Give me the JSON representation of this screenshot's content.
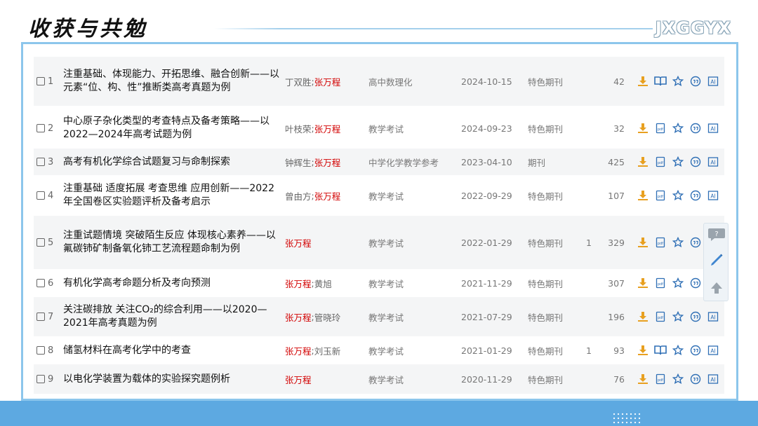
{
  "slide": {
    "title": "收获与共勉",
    "brand": "JXGGYX"
  },
  "colors": {
    "frame": "#8cc6ec",
    "band": "#5da9e1",
    "author_highlight": "#d20000",
    "icon_blue": "#2f6fb5",
    "icon_orange": "#e8a020"
  },
  "rows": [
    {
      "num": "1",
      "title": "注重基础、体现能力、开拓思维、融合创新——以元素“位、构、性”推断类高考真题为例",
      "authors": [
        {
          "name": "丁双胜",
          "hl": false
        },
        {
          "name": "张万程",
          "hl": true
        }
      ],
      "source": "高中数理化",
      "date": "2024-10-15",
      "dbtype": "特色期刊",
      "cited": "",
      "downloads": "42",
      "read_icon": "book"
    },
    {
      "num": "2",
      "title": "中心原子杂化类型的考查特点及备考策略——以2022—2024年高考试题为例",
      "authors": [
        {
          "name": "叶枝荣",
          "hl": false
        },
        {
          "name": "张万程",
          "hl": true
        }
      ],
      "source": "教学考试",
      "date": "2024-09-23",
      "dbtype": "特色期刊",
      "cited": "",
      "downloads": "32",
      "read_icon": "page"
    },
    {
      "num": "3",
      "title": "高考有机化学综合试题复习与命制探索",
      "authors": [
        {
          "name": "钟辉生",
          "hl": false
        },
        {
          "name": "张万程",
          "hl": true
        }
      ],
      "source": "中学化学教学参考",
      "date": "2023-04-10",
      "dbtype": "期刊",
      "cited": "",
      "downloads": "425",
      "read_icon": "page"
    },
    {
      "num": "4",
      "title": "注重基础 适度拓展 考查思维 应用创新——2022年全国卷区实验题评析及备考启示",
      "authors": [
        {
          "name": "曾由方",
          "hl": false
        },
        {
          "name": "张万程",
          "hl": true
        }
      ],
      "source": "教学考试",
      "date": "2022-09-29",
      "dbtype": "特色期刊",
      "cited": "",
      "downloads": "107",
      "read_icon": "page"
    },
    {
      "num": "5",
      "title": "注重试题情境 突破陌生反应 体现核心素养——以氟碳铈矿制备氧化铈工艺流程题命制为例",
      "authors": [
        {
          "name": "张万程",
          "hl": true
        }
      ],
      "source": "教学考试",
      "date": "2022-01-29",
      "dbtype": "特色期刊",
      "cited": "1",
      "downloads": "329",
      "read_icon": "page"
    },
    {
      "num": "6",
      "title": "有机化学高考命题分析及考向预测",
      "authors": [
        {
          "name": "张万程",
          "hl": true
        },
        {
          "name": "黄旭",
          "hl": false
        }
      ],
      "source": "教学考试",
      "date": "2021-11-29",
      "dbtype": "特色期刊",
      "cited": "",
      "downloads": "307",
      "read_icon": "page"
    },
    {
      "num": "7",
      "title": "关注碳排放 关注CO₂的综合利用——以2020—2021年高考真题为例",
      "authors": [
        {
          "name": "张万程",
          "hl": true
        },
        {
          "name": "管晓玲",
          "hl": false
        }
      ],
      "source": "教学考试",
      "date": "2021-07-29",
      "dbtype": "特色期刊",
      "cited": "",
      "downloads": "196",
      "read_icon": "page"
    },
    {
      "num": "8",
      "title": "储氢材料在高考化学中的考查",
      "authors": [
        {
          "name": "张万程",
          "hl": true
        },
        {
          "name": "刘玉新",
          "hl": false
        }
      ],
      "source": "教学考试",
      "date": "2021-01-29",
      "dbtype": "特色期刊",
      "cited": "1",
      "downloads": "93",
      "read_icon": "book"
    },
    {
      "num": "9",
      "title": "以电化学装置为载体的实验探究题例析",
      "authors": [
        {
          "name": "张万程",
          "hl": true
        }
      ],
      "source": "教学考试",
      "date": "2020-11-29",
      "dbtype": "特色期刊",
      "cited": "",
      "downloads": "76",
      "read_icon": "page"
    }
  ],
  "row_ops": [
    "download-icon",
    "read-icon",
    "favorite-icon",
    "quote-icon",
    "ai-icon"
  ],
  "side_tools": [
    "comment-icon",
    "edit-icon",
    "back-to-top-icon"
  ]
}
